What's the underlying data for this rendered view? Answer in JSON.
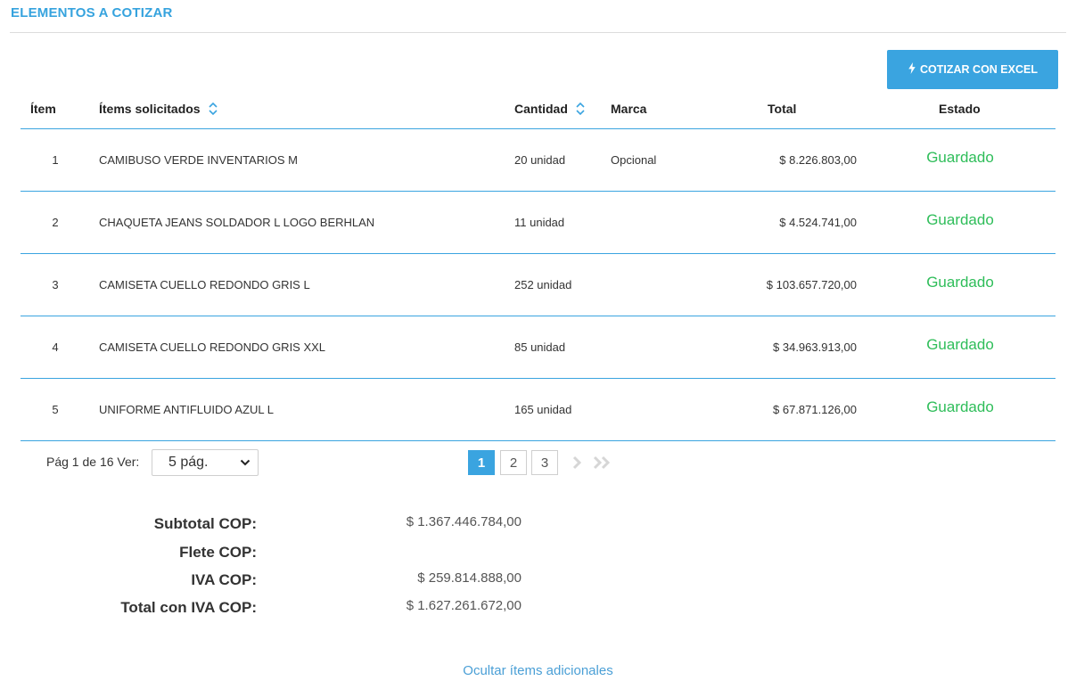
{
  "section": {
    "title": "ELEMENTOS A COTIZAR"
  },
  "toolbar": {
    "excel_button_label": "COTIZAR CON EXCEL",
    "excel_button_icon": "lightning-icon"
  },
  "table": {
    "headers": {
      "item": "Ítem",
      "requested": "Ítems solicitados",
      "quantity": "Cantidad",
      "brand": "Marca",
      "total": "Total",
      "status": "Estado"
    },
    "rows": [
      {
        "item": "1",
        "name": "CAMIBUSO VERDE INVENTARIOS M",
        "quantity": "20 unidad",
        "brand": "Opcional",
        "total": "$ 8.226.803,00",
        "status": "Guardado"
      },
      {
        "item": "2",
        "name": "CHAQUETA JEANS SOLDADOR L LOGO BERHLAN",
        "quantity": "11 unidad",
        "brand": "",
        "total": "$ 4.524.741,00",
        "status": "Guardado"
      },
      {
        "item": "3",
        "name": "CAMISETA CUELLO REDONDO GRIS L",
        "quantity": "252 unidad",
        "brand": "",
        "total": "$ 103.657.720,00",
        "status": "Guardado"
      },
      {
        "item": "4",
        "name": "CAMISETA CUELLO REDONDO GRIS XXL",
        "quantity": "85 unidad",
        "brand": "",
        "total": "$ 34.963.913,00",
        "status": "Guardado"
      },
      {
        "item": "5",
        "name": "UNIFORME ANTIFLUIDO AZUL L",
        "quantity": "165 unidad",
        "brand": "",
        "total": "$ 67.871.126,00",
        "status": "Guardado"
      }
    ]
  },
  "pagination": {
    "info": "Pág 1 de 16 Ver:",
    "per_page": "5 pág.",
    "pages": [
      "1",
      "2",
      "3"
    ],
    "current": "1"
  },
  "summary": {
    "subtotal_label": "Subtotal COP:",
    "subtotal_value": "$ 1.367.446.784,00",
    "freight_label": "Flete COP:",
    "freight_value": "",
    "iva_label": "IVA COP:",
    "iva_value": "$ 259.814.888,00",
    "total_label": "Total con IVA COP:",
    "total_value": "$ 1.627.261.672,00"
  },
  "footer": {
    "toggle_link": "Ocultar ítems adicionales"
  },
  "colors": {
    "accent": "#3aa4e0",
    "status_ok": "#2ebd59",
    "title": "#36a3de"
  }
}
